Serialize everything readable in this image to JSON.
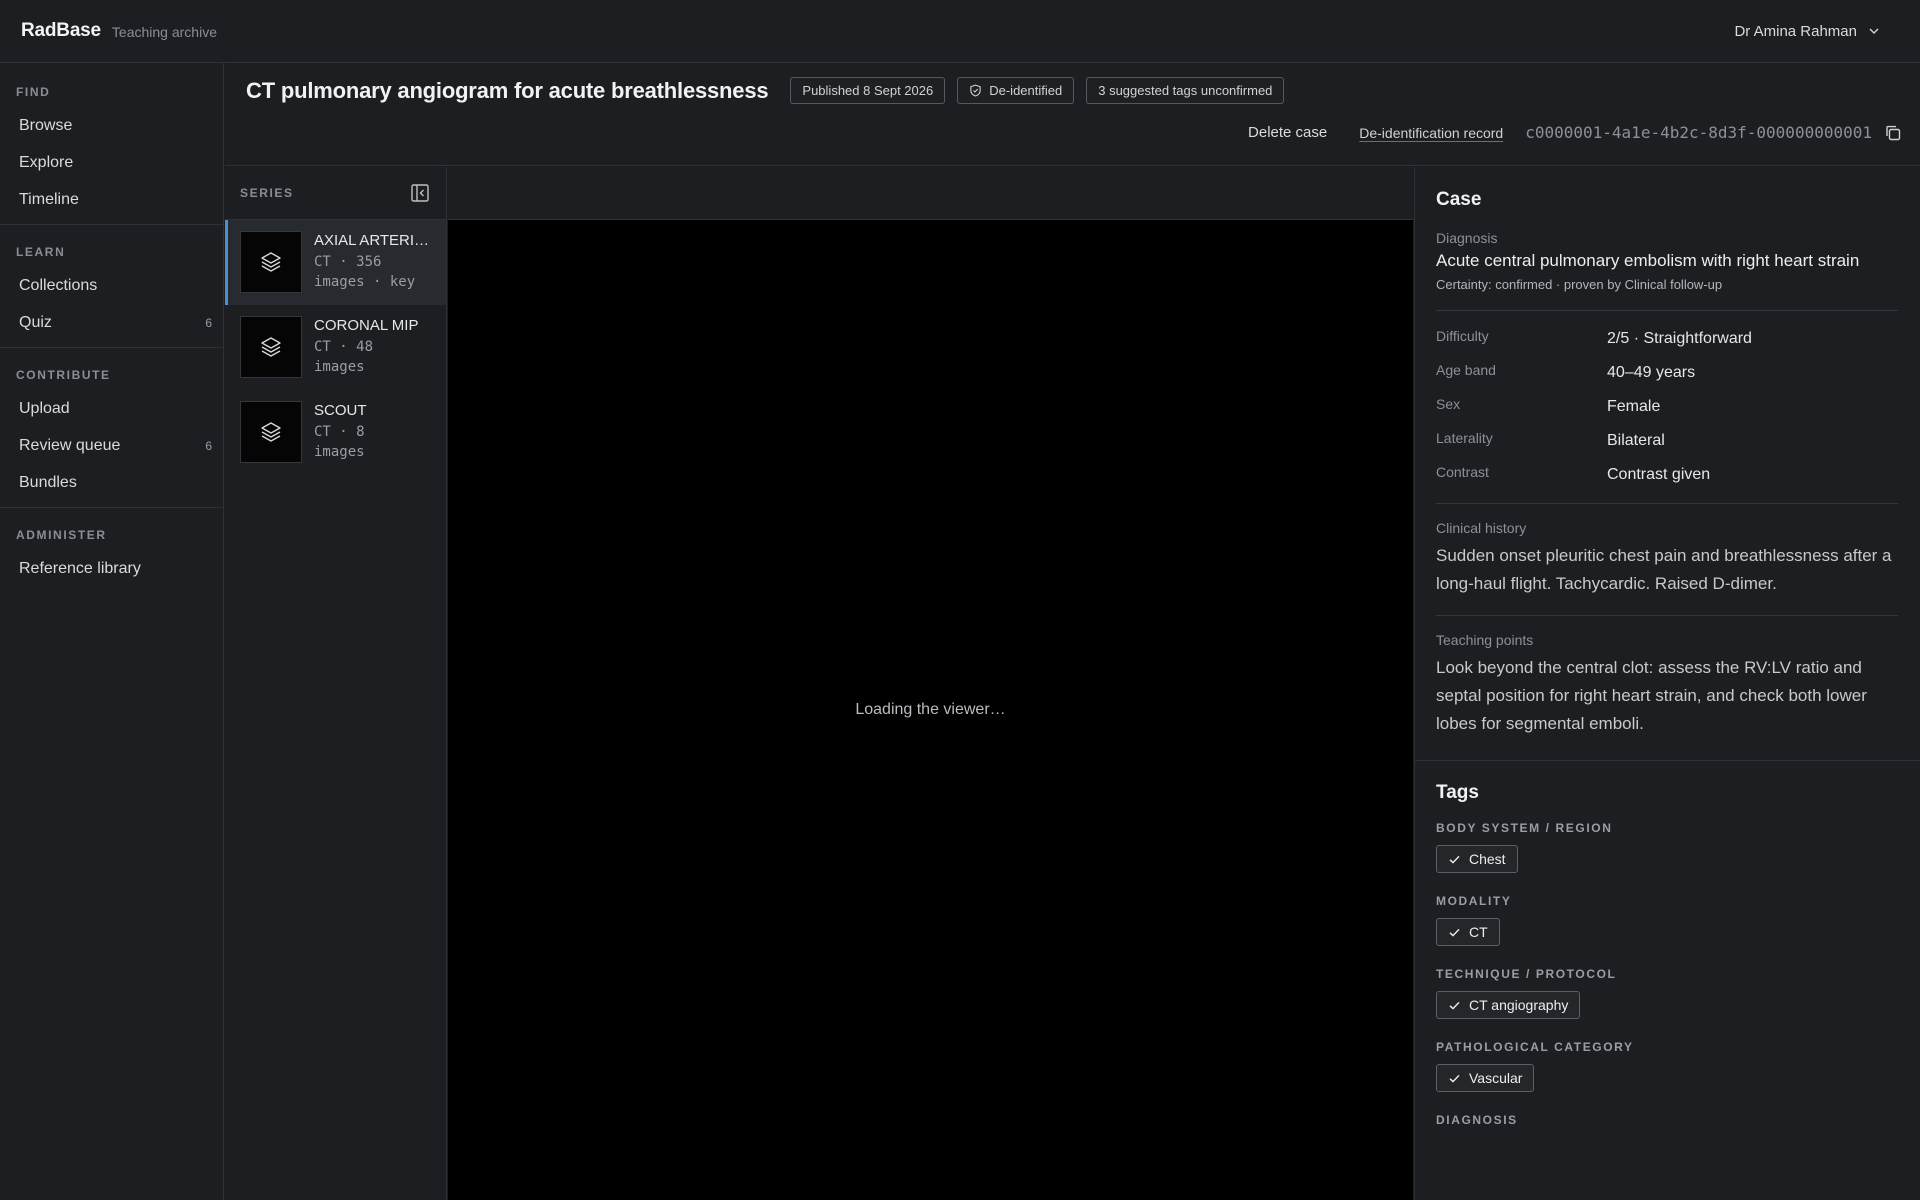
{
  "app": {
    "brand": "RadBase",
    "brand_subtitle": "Teaching archive",
    "user_name": "Dr Amina Rahman"
  },
  "sidebar": {
    "sections": [
      {
        "heading": "FIND",
        "items": [
          {
            "label": "Browse"
          },
          {
            "label": "Explore"
          },
          {
            "label": "Timeline"
          }
        ]
      },
      {
        "heading": "LEARN",
        "items": [
          {
            "label": "Collections"
          },
          {
            "label": "Quiz",
            "count": "6"
          }
        ]
      },
      {
        "heading": "CONTRIBUTE",
        "items": [
          {
            "label": "Upload"
          },
          {
            "label": "Review queue",
            "count": "6"
          },
          {
            "label": "Bundles"
          }
        ]
      },
      {
        "heading": "ADMINISTER",
        "items": [
          {
            "label": "Reference library"
          }
        ]
      }
    ]
  },
  "case": {
    "title": "CT pulmonary angiogram for acute breathlessness",
    "badges": {
      "published": "Published 8 Sept 2026",
      "deidentified": "De-identified",
      "suggested_tags": "3 suggested tags unconfirmed"
    },
    "actions": {
      "delete": "Delete case",
      "deid_record": "De-identification record"
    },
    "case_id": "c0000001-4a1e-4b2c-8d3f-000000000001"
  },
  "series": {
    "label": "SERIES",
    "items": [
      {
        "name": "AXIAL ARTERIAL",
        "meta_line1": "CT · 356",
        "meta_line2": "images · key"
      },
      {
        "name": "CORONAL MIP",
        "meta_line1": "CT · 48",
        "meta_line2": "images"
      },
      {
        "name": "SCOUT",
        "meta_line1": "CT · 8",
        "meta_line2": "images"
      }
    ]
  },
  "viewer": {
    "loading_text": "Loading the viewer…"
  },
  "details": {
    "case_heading": "Case",
    "diagnosis_label": "Diagnosis",
    "diagnosis": "Acute central pulmonary embolism with right heart strain",
    "certainty": "Certainty: confirmed · proven by Clinical follow-up",
    "fields": [
      {
        "key": "Difficulty",
        "value": "2/5 · Straightforward"
      },
      {
        "key": "Age band",
        "value": "40–49 years"
      },
      {
        "key": "Sex",
        "value": "Female"
      },
      {
        "key": "Laterality",
        "value": "Bilateral"
      },
      {
        "key": "Contrast",
        "value": "Contrast given"
      }
    ],
    "clinical_history_label": "Clinical history",
    "clinical_history": "Sudden onset pleuritic chest pain and breathlessness after a long-haul flight. Tachycardic. Raised D-dimer.",
    "teaching_points_label": "Teaching points",
    "teaching_points": "Look beyond the central clot: assess the RV:LV ratio and septal position for right heart strain, and check both lower lobes for segmental emboli."
  },
  "tags": {
    "heading": "Tags",
    "groups": [
      {
        "heading": "BODY SYSTEM / REGION",
        "tag": "Chest"
      },
      {
        "heading": "MODALITY",
        "tag": "CT"
      },
      {
        "heading": "TECHNIQUE / PROTOCOL",
        "tag": "CT angiography"
      },
      {
        "heading": "PATHOLOGICAL CATEGORY",
        "tag": "Vascular"
      }
    ],
    "next_heading": "DIAGNOSIS"
  },
  "colors": {
    "accent": "#4a90d9",
    "background": "#1a1c1f",
    "viewer_bg": "#000000"
  },
  "icons": {
    "user_menu": "chevron-down-icon",
    "deidentified": "shield-check-icon",
    "copy": "copy-icon",
    "collapse": "collapse-panel-icon",
    "series_thumb": "layers-icon",
    "tag_confirmed": "check-icon"
  }
}
